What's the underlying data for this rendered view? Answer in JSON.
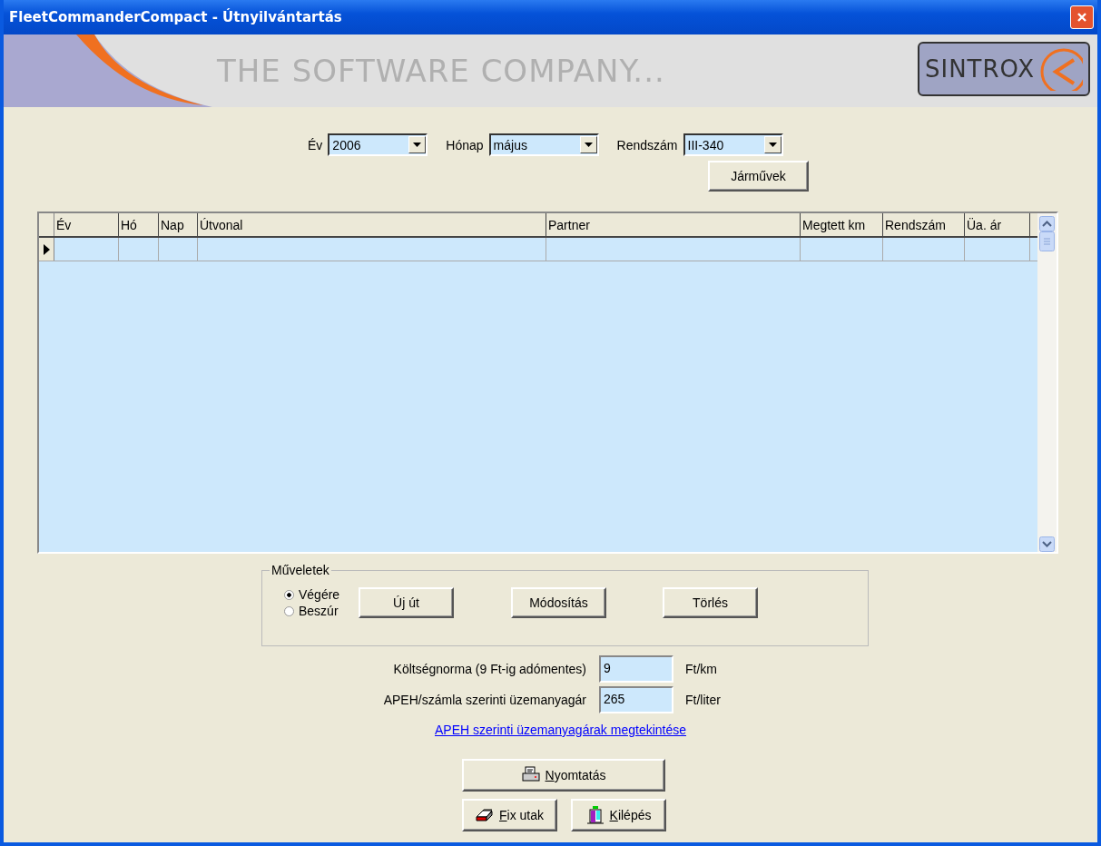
{
  "window": {
    "title": "FleetCommanderCompact - Útnyilvántartás"
  },
  "banner": {
    "slogan": "THE SOFTWARE COMPANY...",
    "logo": "SINTROX"
  },
  "filters": [
    {
      "label": "Év",
      "value": "2006"
    },
    {
      "label": "Hónap",
      "value": "május"
    },
    {
      "label": "Rendszám",
      "value": "III-340"
    }
  ],
  "vehicles_button": "Járművek",
  "table": {
    "columns": [
      "Év",
      "Hó",
      "Nap",
      "Útvonal",
      "Partner",
      "Megtett km",
      "Rendszám",
      "Üa. ár"
    ],
    "rows": [
      {
        "current": true,
        "cells": [
          "",
          "",
          "",
          "",
          "",
          "",
          "",
          ""
        ]
      }
    ]
  },
  "operations": {
    "title": "Műveletek",
    "options": [
      {
        "label": "Végére",
        "selected": true
      },
      {
        "label": "Beszúr",
        "selected": false
      }
    ],
    "buttons": [
      "Új út",
      "Módosítás",
      "Törlés"
    ]
  },
  "fields": [
    {
      "label": "Költségnorma (9 Ft-ig adómentes)",
      "value": "9",
      "unit": "Ft/km"
    },
    {
      "label": "APEH/számla szerinti üzemanyagár",
      "value": "265",
      "unit": "Ft/liter"
    }
  ],
  "link": "APEH szerinti üzemanyagárak megtekintése",
  "actions": [
    {
      "kind": "print",
      "label": "Nyomtatás",
      "mnemonic_underlined": true
    },
    {
      "kind": "fixed",
      "label": "Fix utak",
      "mnemonic_underlined": true
    },
    {
      "kind": "exit",
      "label": "Kilépés",
      "mnemonic_underlined": true
    }
  ]
}
